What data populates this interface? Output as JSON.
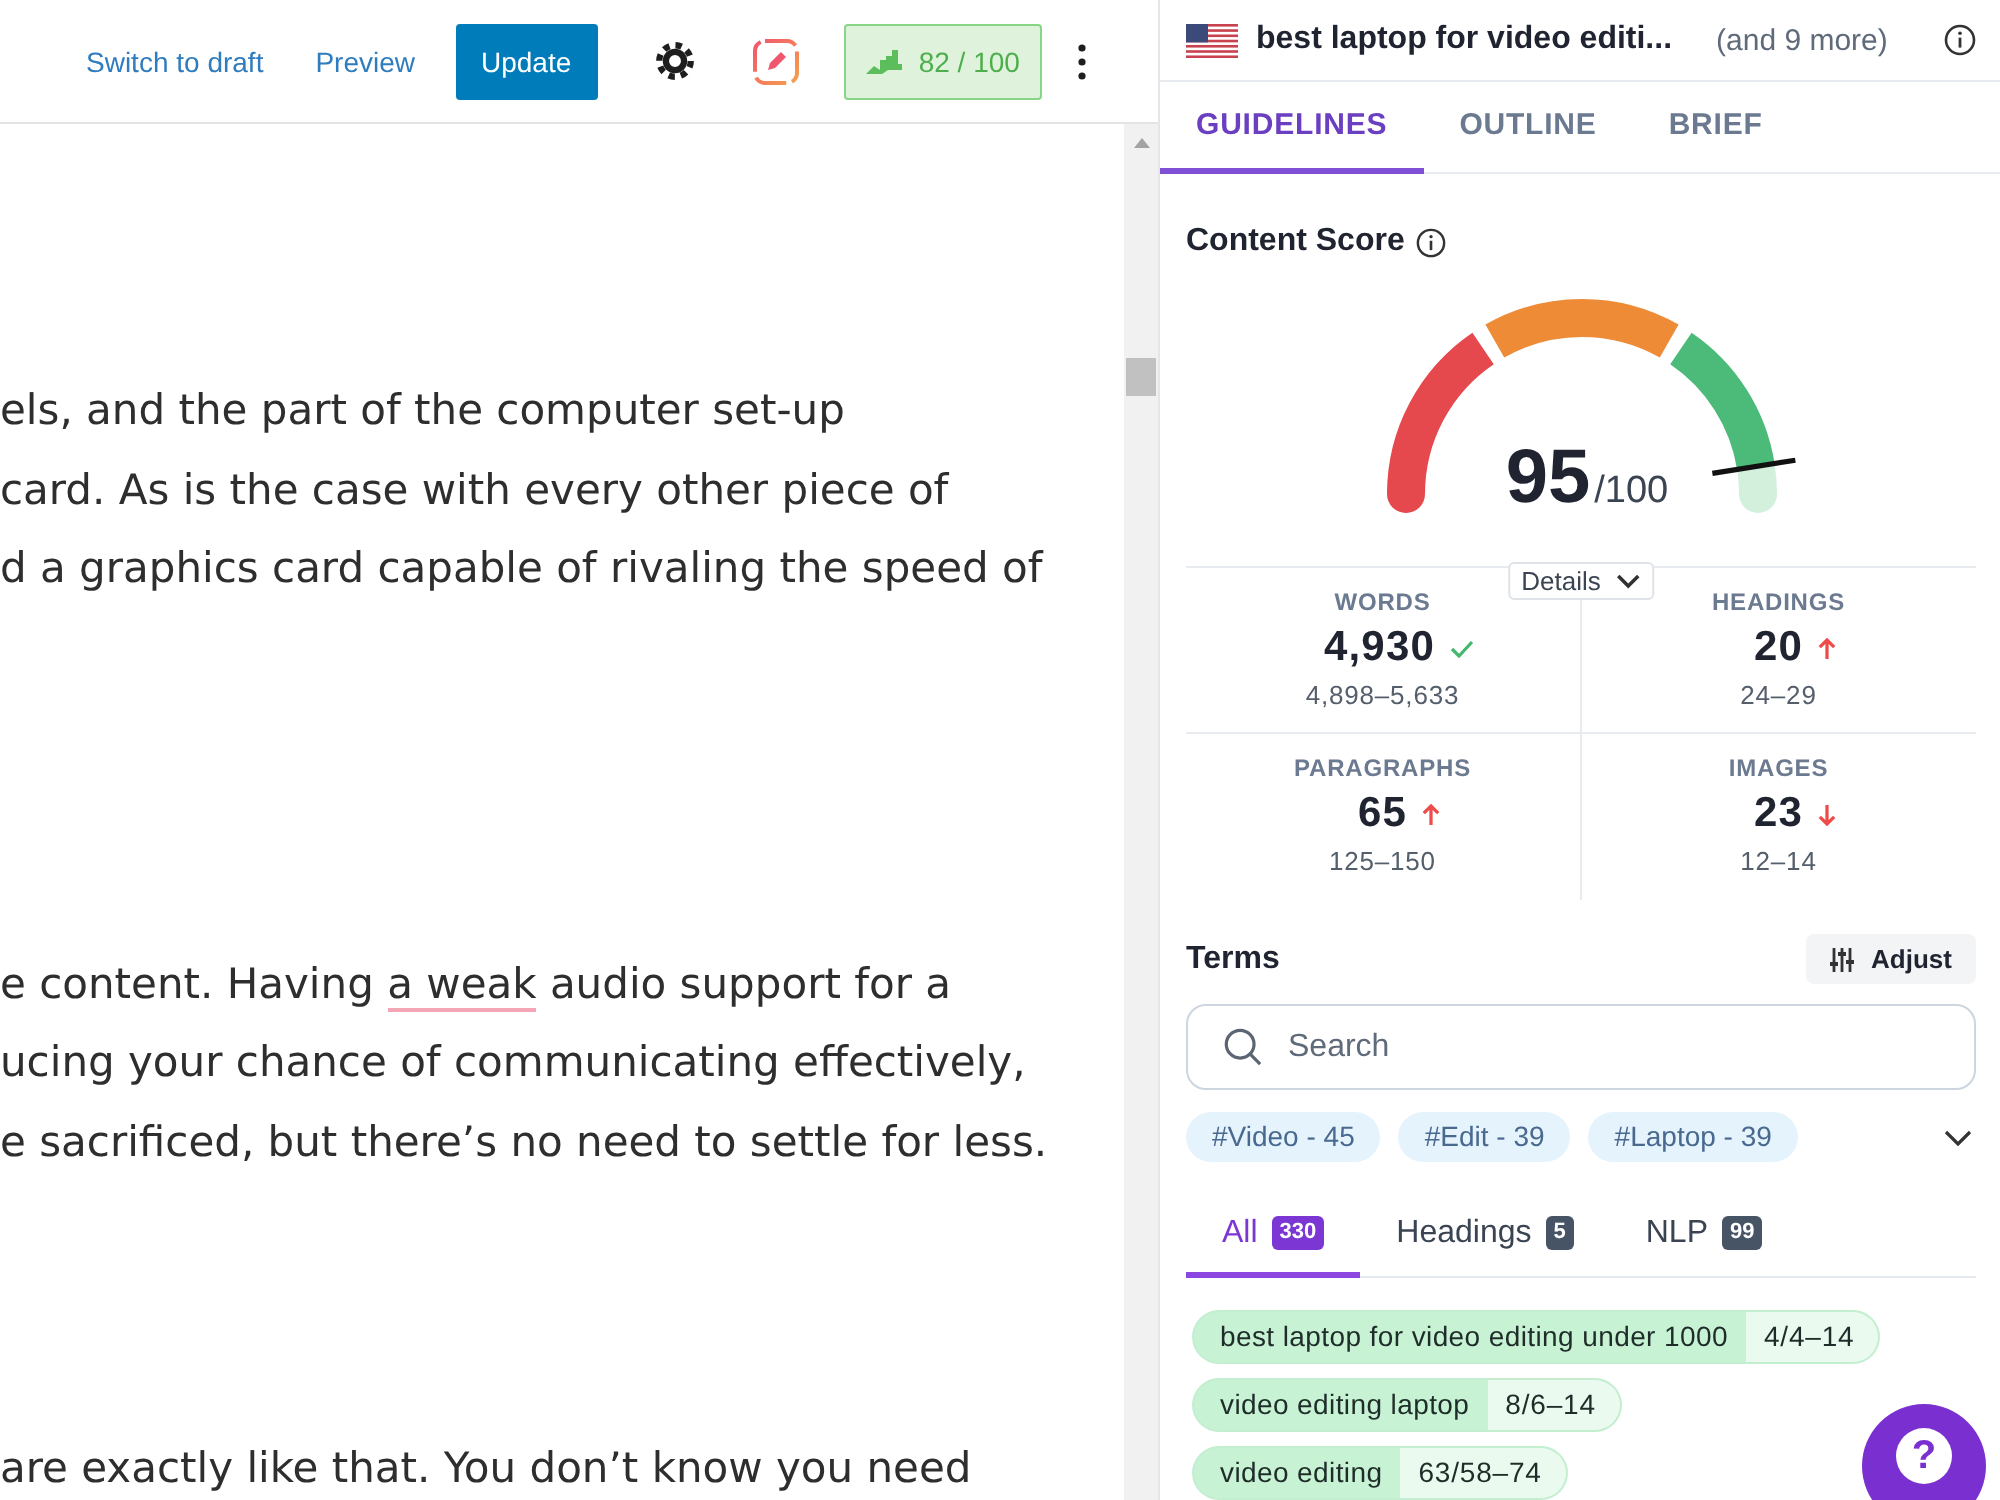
{
  "toolbar": {
    "links": [
      {
        "label": "Switch to draft"
      },
      {
        "label": "Preview"
      }
    ],
    "primary_button": "Update",
    "score_button": {
      "label": "82 / 100"
    }
  },
  "editor": {
    "paragraphs": [
      {
        "lines": [
          {
            "segments": [
              {
                "text": "els, and the part of the computer set-up",
                "flagged": false
              }
            ]
          },
          {
            "segments": [
              {
                "text": " card. As is the case with every other piece of",
                "flagged": false
              }
            ]
          },
          {
            "segments": [
              {
                "text": "d a graphics card capable of rivaling the speed of",
                "flagged": false
              }
            ]
          }
        ]
      },
      {
        "lines": [
          {
            "segments": [
              {
                "text": "e content. Having ",
                "flagged": false
              },
              {
                "text": "a weak",
                "flagged": true
              },
              {
                "text": " audio support for a",
                "flagged": false
              }
            ]
          },
          {
            "segments": [
              {
                "text": "ucing your chance of communicating effectively,",
                "flagged": false
              }
            ]
          },
          {
            "segments": [
              {
                "text": "e sacrificed, but there’s no need to settle for less.",
                "flagged": false
              }
            ]
          }
        ]
      },
      {
        "lines": [
          {
            "segments": [
              {
                "text": "are exactly like that. You don’t know you need",
                "flagged": false
              }
            ]
          }
        ]
      }
    ]
  },
  "keyword_header": {
    "title": "best laptop for video editi...",
    "more": "(and 9 more)"
  },
  "tabs": [
    {
      "label": "GUIDELINES",
      "selected": true
    },
    {
      "label": "OUTLINE",
      "selected": false
    },
    {
      "label": "BRIEF",
      "selected": false
    }
  ],
  "content_score": {
    "title": "Content Score",
    "score": "95",
    "max": "/100",
    "level": 0.95,
    "details": "Details"
  },
  "stats": [
    {
      "label": "WORDS",
      "value": "4,930",
      "kind": "ok",
      "range": "4,898–5,633"
    },
    {
      "label": "HEADINGS",
      "value": "20",
      "kind": "increase",
      "range": "24–29"
    },
    {
      "label": "PARAGRAPHS",
      "value": "65",
      "kind": "increase",
      "range": "125–150"
    },
    {
      "label": "IMAGES",
      "value": "23",
      "kind": "decrease",
      "range": "12–14"
    }
  ],
  "terms": {
    "title": "Terms",
    "adjust": "Adjust",
    "search": {
      "placeholder": "Search"
    },
    "topics": [
      {
        "label": "#Video - 45"
      },
      {
        "label": "#Edit - 39"
      },
      {
        "label": "#Laptop - 39"
      }
    ],
    "tabs": [
      {
        "label": "All",
        "count": "330",
        "selected": true
      },
      {
        "label": "Headings",
        "count": "5",
        "selected": false
      },
      {
        "label": "NLP",
        "count": "99",
        "selected": false
      }
    ],
    "items": [
      {
        "term": "best laptop for video editing under 1000",
        "count": "4/4–14"
      },
      {
        "term": "video editing laptop",
        "count": "8/6–14"
      },
      {
        "term": "video editing",
        "count": "63/58–74"
      }
    ]
  },
  "help_button": {
    "label": "?"
  }
}
